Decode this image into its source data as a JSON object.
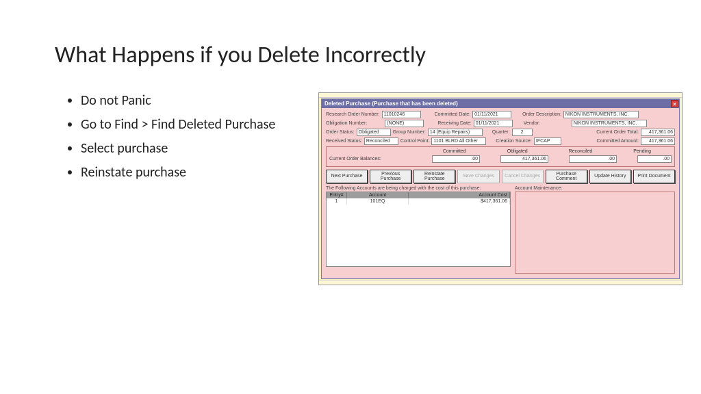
{
  "slide": {
    "title": "What Happens if you Delete Incorrectly",
    "bullets": [
      "Do not Panic",
      "Go to Find > Find Deleted Purchase",
      "Select purchase",
      "Reinstate purchase"
    ]
  },
  "dialog": {
    "title": "Deleted Purchase (Purchase that has been deleted)",
    "labels": {
      "research_order_number": "Research Order Number:",
      "committed_date": "Committed Date:",
      "order_description": "Order Description:",
      "obligation_number": "Obligation Number:",
      "receiving_date": "Receiving Date:",
      "vendor": "Vendor:",
      "order_status": "Order Status:",
      "group_number": "Group Number:",
      "quarter": "Quarter:",
      "current_order_total": "Current Order Total:",
      "received_status": "Received Status:",
      "control_point": "Control Point:",
      "creation_source": "Creation Source:",
      "committed_amount": "Committed Amount:",
      "current_order_balances": "Current Order Balances:",
      "committed": "Committed",
      "obligated": "Obligated",
      "reconciled": "Reconciled",
      "pending": "Pending",
      "accounts_charged": "The Following Accounts are being charged with the cost of this purchase:",
      "account_maintenance": "Account Maintenance:",
      "col_entry": "Entry#",
      "col_account": "Account",
      "col_account_cost": "Account Cost"
    },
    "values": {
      "research_order_number": "11010246",
      "committed_date": "01/11/2021",
      "order_description": "NIKON INSTRUMENTS, INC.",
      "obligation_number": "(NONE)",
      "receiving_date": "01/11/2021",
      "vendor": "NIKON INSTRUMENTS, INC.",
      "order_status": "Obligated",
      "group_number": "14 (Equip Repairs)",
      "quarter": "2",
      "current_order_total": "417,361.06",
      "received_status": "Reconciled",
      "control_point": "1101 BLRD All Other",
      "creation_source": "IFCAP",
      "committed_amount": "417,361.06",
      "bal_committed": ".00",
      "bal_obligated": "417,361.06",
      "bal_reconciled": ".00",
      "bal_pending": ".00"
    },
    "buttons": {
      "next": "Next Purchase",
      "prev": "Previous Purchase",
      "reinstate": "Reinstate Purchase",
      "save": "Save Changes",
      "cancel": "Cancel Changes",
      "comment": "Purchase Comment",
      "update": "Update History",
      "print": "Print Document"
    },
    "account_rows": [
      {
        "entry": "1",
        "account": "101EQ",
        "cost": "$417,361.06"
      }
    ]
  }
}
